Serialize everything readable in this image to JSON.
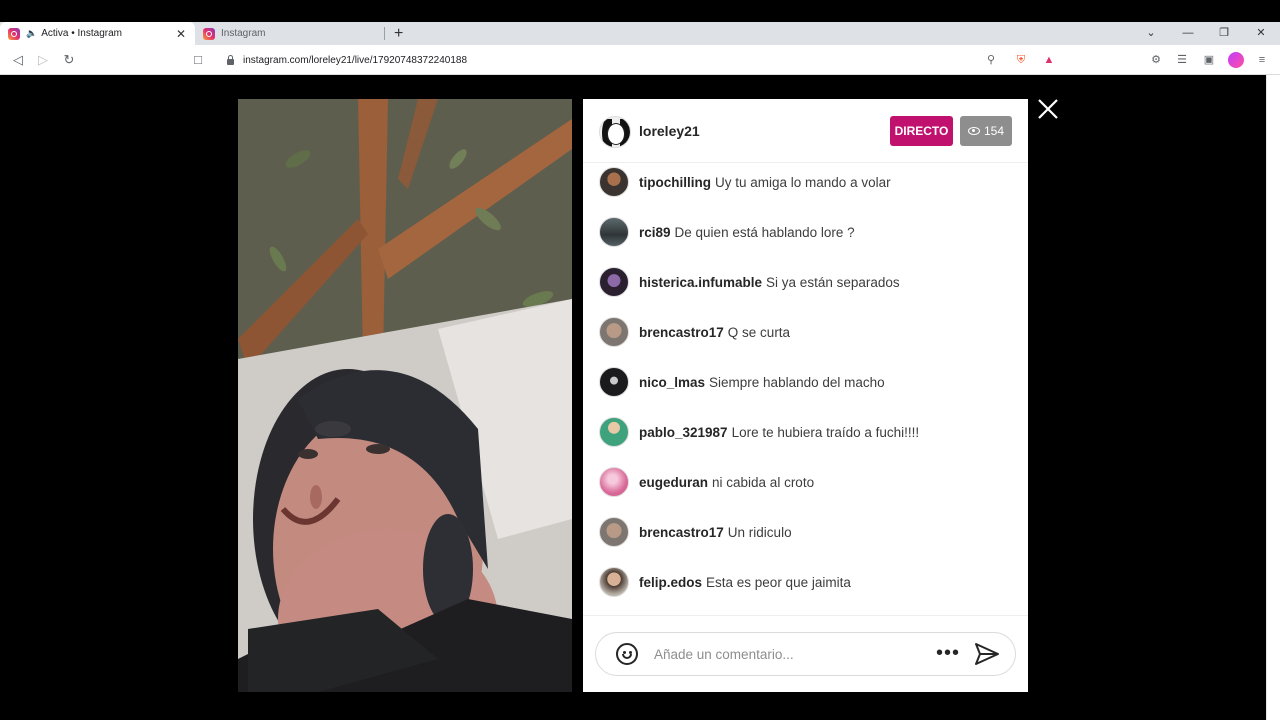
{
  "browser": {
    "tabs": [
      {
        "title": "Activa • Instagram",
        "active": true,
        "audio": true
      },
      {
        "title": "Instagram",
        "active": false
      }
    ],
    "url": "instagram.com/loreley21/live/17920748372240188",
    "accent": "#dee1e6"
  },
  "live": {
    "host": "loreley21",
    "live_label": "DIRECTO",
    "viewer_count": "154",
    "live_color": "#c1116f"
  },
  "comments": [
    {
      "user": "tipochilling",
      "text": "Uy tu amiga lo mando a volar"
    },
    {
      "user": "rci89",
      "text": "De quien está hablando lore ?"
    },
    {
      "user": "histerica.infumable",
      "text": "Si ya están separados"
    },
    {
      "user": "brencastro17",
      "text": "Q se curta"
    },
    {
      "user": "nico_lmas",
      "text": "Siempre hablando del macho"
    },
    {
      "user": "pablo_321987",
      "text": "Lore te hubiera traído a fuchi!!!!"
    },
    {
      "user": "eugeduran",
      "text": "ni cabida al croto"
    },
    {
      "user": "brencastro17",
      "text": "Un ridiculo"
    },
    {
      "user": "felip.edos",
      "text": "Esta es peor que jaimita"
    }
  ],
  "composer": {
    "placeholder": "Añade un comentario...",
    "more_label": "•••"
  }
}
